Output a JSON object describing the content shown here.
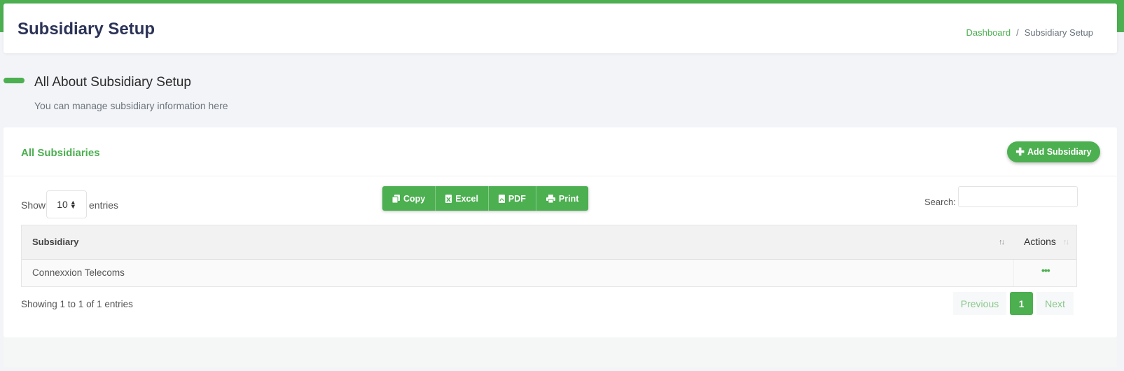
{
  "header": {
    "title": "Subsidiary Setup",
    "breadcrumb": {
      "home": "Dashboard",
      "separator": "/",
      "current": "Subsidiary Setup"
    }
  },
  "about": {
    "title": "All About Subsidiary Setup",
    "subtitle": "You can manage subsidiary information here"
  },
  "card": {
    "title": "All Subsidiaries",
    "add_button": "Add Subsidiary",
    "add_icon": "plus-icon"
  },
  "table_controls": {
    "show_label": "Show",
    "page_length": "10",
    "entries_label": "entries",
    "search_label": "Search:",
    "search_value": "",
    "export_buttons": [
      {
        "label": "Copy",
        "icon": "copy-icon"
      },
      {
        "label": "Excel",
        "icon": "excel-file-icon"
      },
      {
        "label": "PDF",
        "icon": "pdf-file-icon"
      },
      {
        "label": "Print",
        "icon": "print-icon"
      }
    ]
  },
  "table": {
    "columns": [
      "Subsidiary",
      "Actions"
    ],
    "rows": [
      {
        "subsidiary": "Connexxion Telecoms",
        "actions": "•••"
      }
    ]
  },
  "footer": {
    "info": "Showing 1 to 1 of 1 entries",
    "pagination": {
      "previous": "Previous",
      "current": "1",
      "next": "Next"
    }
  },
  "colors": {
    "accent": "#4caf50",
    "title": "#2c3357",
    "background": "#f3f4f8"
  }
}
